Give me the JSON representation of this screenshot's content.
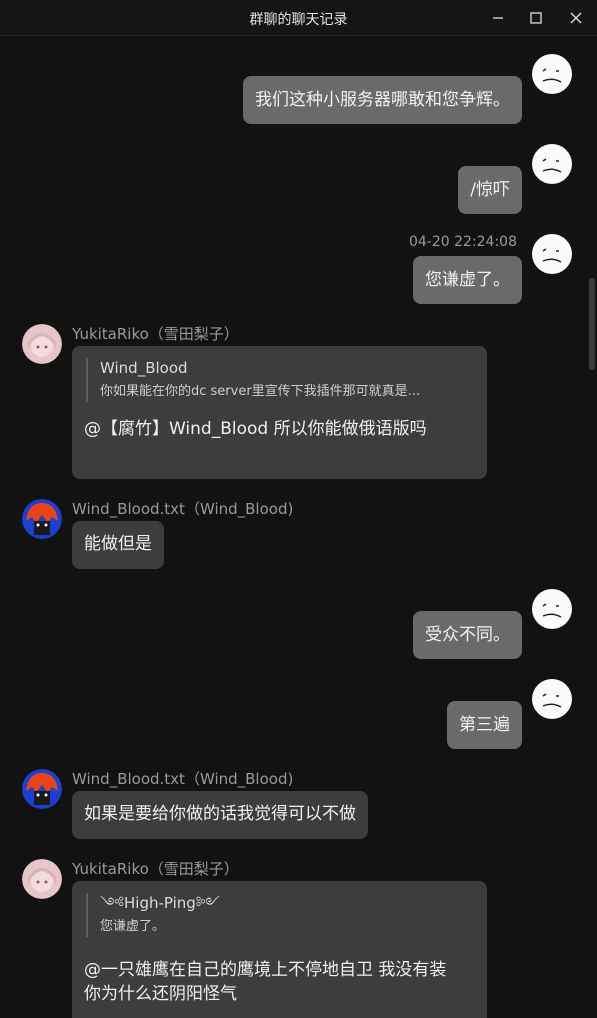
{
  "window": {
    "title": "群聊的聊天记录"
  },
  "messages": [
    {
      "from": "me",
      "text": "我们这种小服务器哪敢和您争辉。"
    },
    {
      "from": "me",
      "text": "/惊吓"
    },
    {
      "from": "me",
      "timestamp": "04-20 22:24:08",
      "text": "您谦虚了。"
    },
    {
      "from": "other",
      "sender": "YukitaRiko（雪田梨子）",
      "quote": {
        "name": "Wind_Blood",
        "text": "你如果能在你的dc server里宣传下我插件那可就真是..."
      },
      "text": "@【腐竹】Wind_Blood 所以你能做俄语版吗"
    },
    {
      "from": "other",
      "sender": "Wind_Blood.txt（Wind_Blood)",
      "text": "能做但是"
    },
    {
      "from": "me",
      "text": "受众不同。"
    },
    {
      "from": "me",
      "text": "第三遍"
    },
    {
      "from": "other",
      "sender": "Wind_Blood.txt（Wind_Blood)",
      "text": "如果是要给你做的话我觉得可以不做"
    },
    {
      "from": "other",
      "sender": "YukitaRiko（雪田梨子）",
      "quote": {
        "name": "༺High-Ping༻",
        "text": "您谦虚了。"
      },
      "text": "@一只雄鹰在自己的鹰境上不停地自卫 我没有装",
      "text2": "你为什么还阴阳怪气"
    }
  ],
  "colors": {
    "background": "#121212",
    "bubble_me": "#6a6a6a",
    "bubble_other": "#3d3d3d",
    "meta_text": "#9a9a9a"
  },
  "icons": {
    "minimize": "minimize-icon",
    "maximize": "maximize-icon",
    "close": "close-icon",
    "self_avatar": "sad-face-avatar"
  }
}
